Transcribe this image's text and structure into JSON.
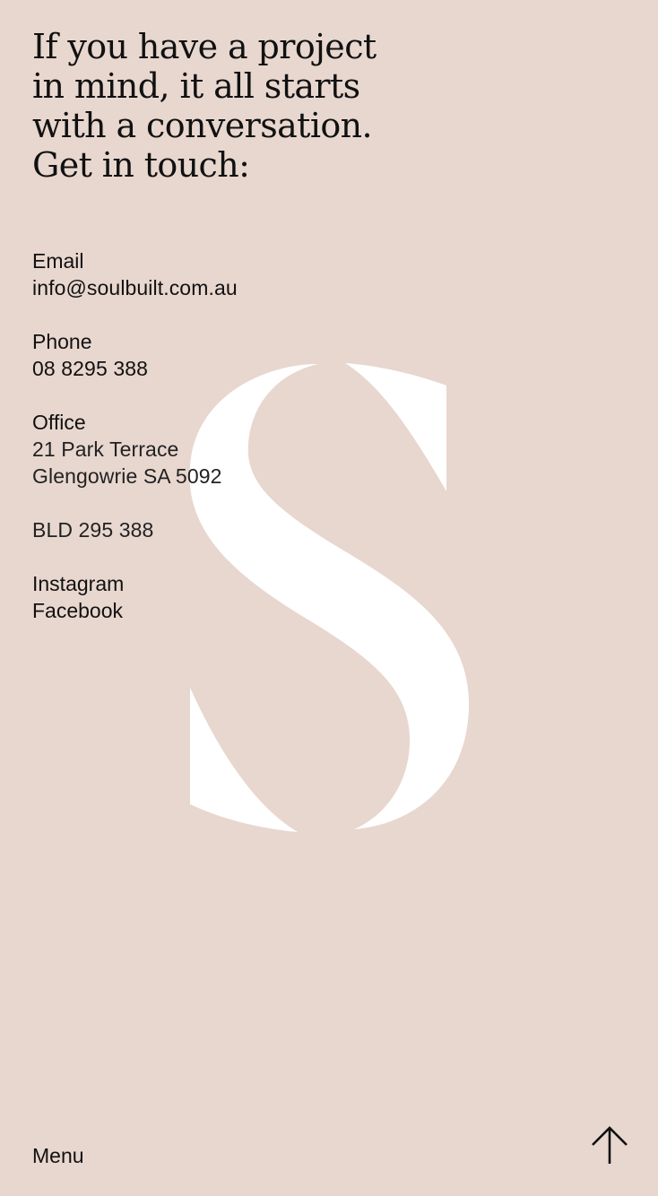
{
  "heading": "If you have a project\nin mind, it all starts\nwith a conversation.\nGet in touch:",
  "contact": {
    "email": {
      "label": "Email",
      "value": "info@soulbuilt.com.au"
    },
    "phone": {
      "label": "Phone",
      "value": "08 8295 388"
    },
    "office": {
      "label": "Office",
      "line1": "21 Park Terrace",
      "line2": "Glengowrie SA 5092"
    },
    "license": "BLD 295 388",
    "social": {
      "instagram": "Instagram",
      "facebook": "Facebook"
    }
  },
  "footer": {
    "menu_label": "Menu",
    "scroll_top_icon": "arrow-up-icon"
  },
  "brand": {
    "logo_icon": "letter-s-logo",
    "background_color": "#e8d7cf",
    "logo_color": "#ffffff",
    "text_color": "#111111"
  }
}
